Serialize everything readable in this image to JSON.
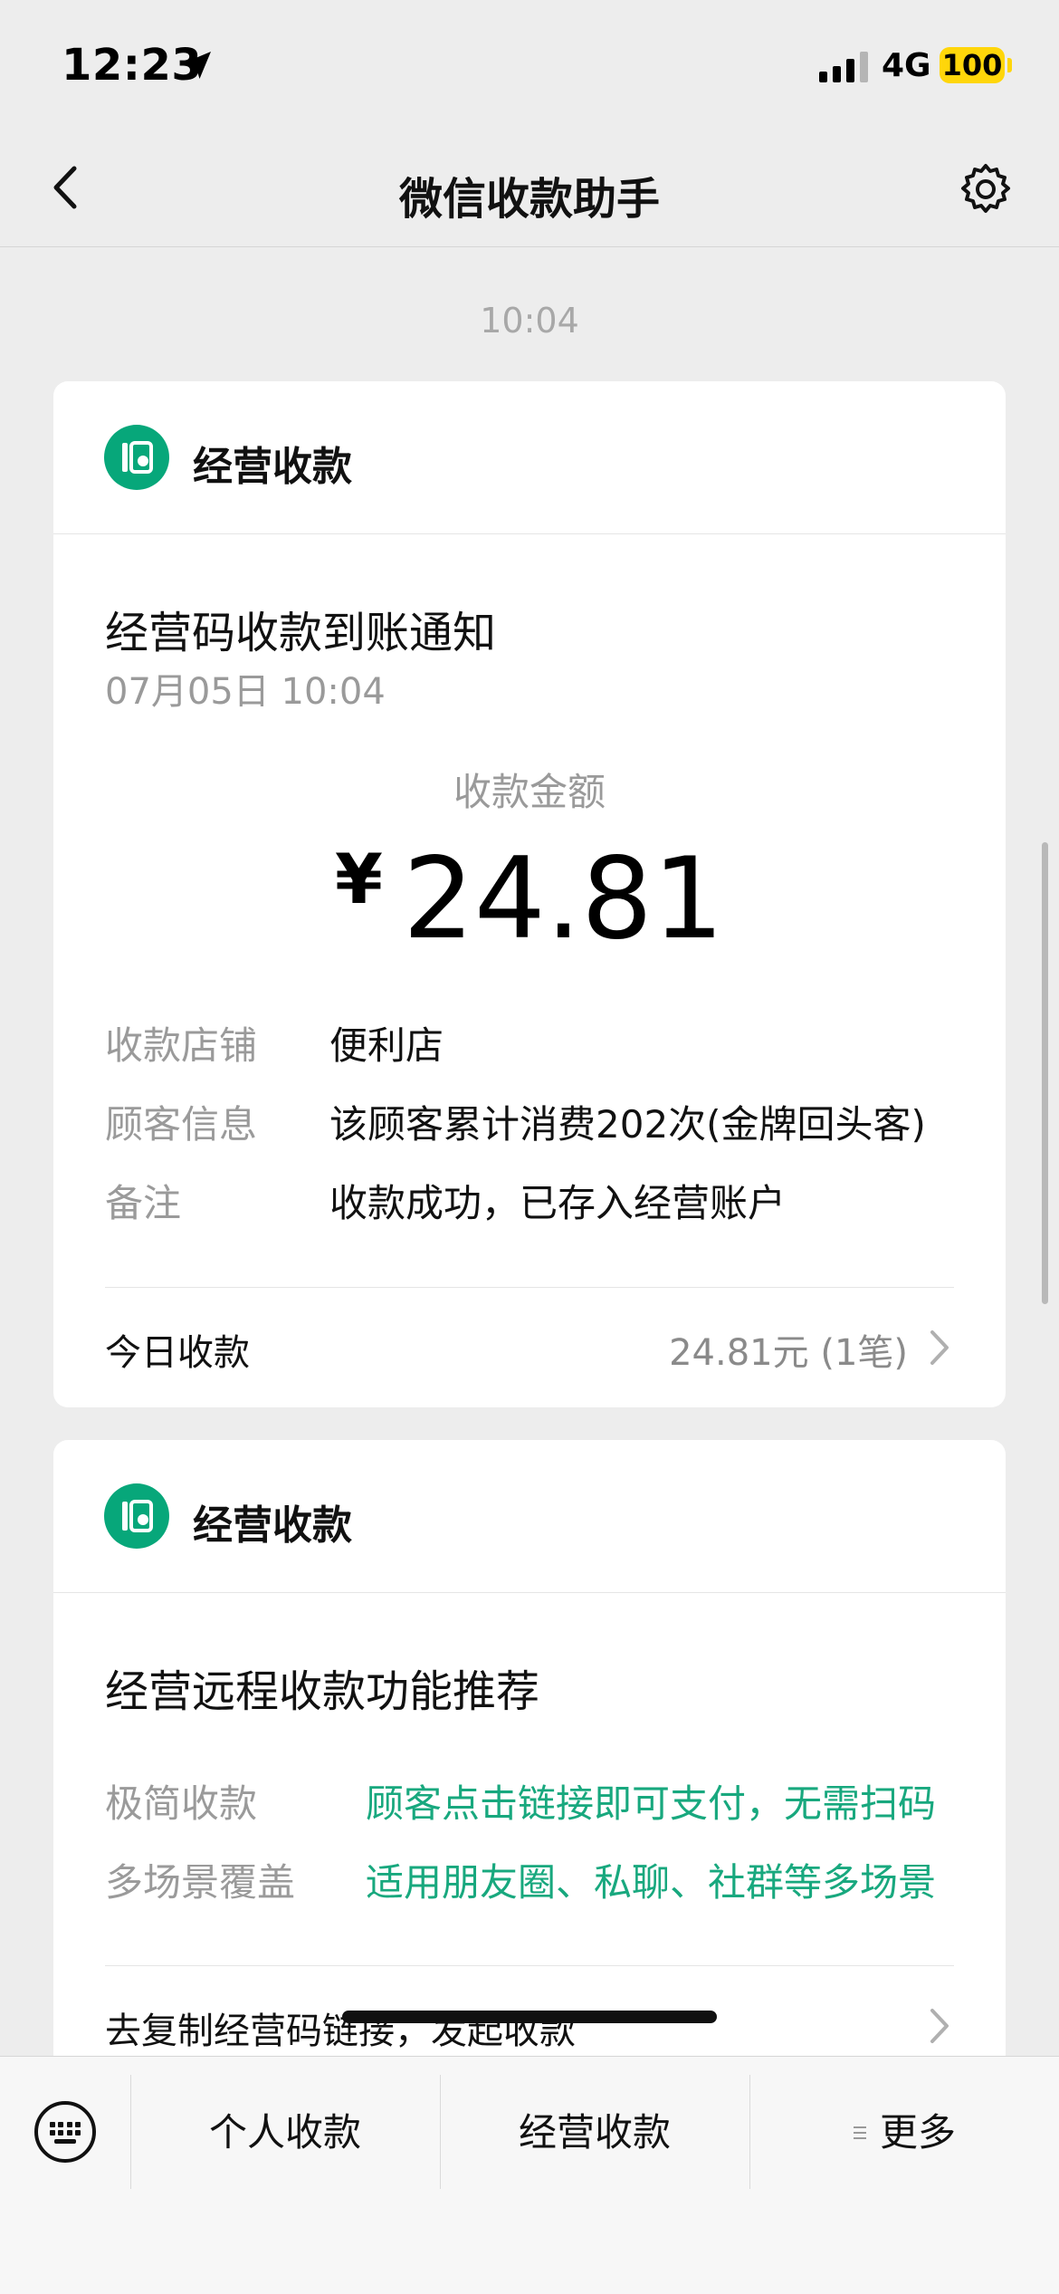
{
  "status_bar": {
    "time": "12:23",
    "network": "4G",
    "battery": "100"
  },
  "nav": {
    "title": "微信收款助手"
  },
  "message_time": "10:04",
  "card1": {
    "header": "经营收款",
    "title": "经营码收款到账通知",
    "date": "07月05日 10:04",
    "amount_label": "收款金额",
    "currency": "¥",
    "amount": "24.81",
    "rows": [
      {
        "label": "收款店铺",
        "value": "便利店"
      },
      {
        "label": "顾客信息",
        "value": "该顾客累计消费202次(金牌回头客)"
      },
      {
        "label": "备注",
        "value": "收款成功，已存入经营账户"
      }
    ],
    "footer_label": "今日收款",
    "footer_value": "24.81元 (1笔)"
  },
  "card2": {
    "header": "经营收款",
    "title": "经营远程收款功能推荐",
    "rows": [
      {
        "label": "极简收款",
        "value": "顾客点击链接即可支付，无需扫码"
      },
      {
        "label": "多场景覆盖",
        "value": "适用朋友圈、私聊、社群等多场景"
      }
    ],
    "footer_label": "去复制经营码链接，发起收款"
  },
  "bottom_bar": {
    "items": [
      "个人收款",
      "经营收款",
      "更多"
    ]
  },
  "colors": {
    "accent_green": "#07A77A",
    "link_green": "#18A87E",
    "background": "#EDEDED"
  }
}
